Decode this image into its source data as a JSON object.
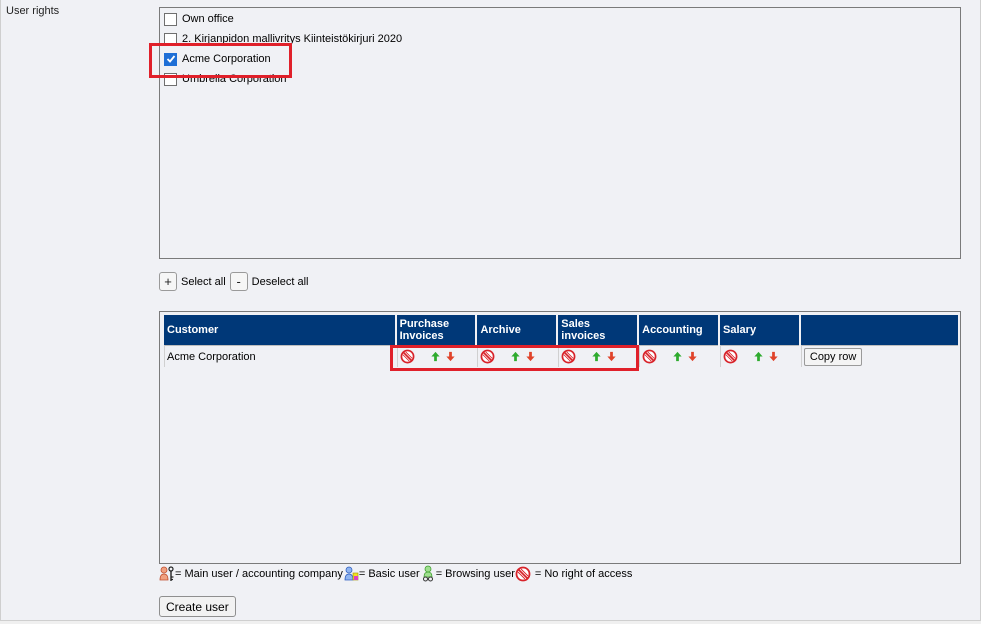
{
  "section_label": "User rights",
  "companies": [
    {
      "label": "Own office",
      "checked": false
    },
    {
      "label": "2. Kirjanpidon mallivritys Kiinteistökirjuri 2020",
      "checked": false
    },
    {
      "label": "Acme Corporation",
      "checked": true
    },
    {
      "label": "Umbrella Corporation",
      "checked": false
    }
  ],
  "select_bar": {
    "plus": "+",
    "select_all": "Select all",
    "minus": "-",
    "deselect_all": "Deselect all"
  },
  "rights_table": {
    "headers": {
      "customer": "Customer",
      "purchase_l1": "Purchase",
      "purchase_l2": "Invoices",
      "archive": "Archive",
      "sales_l1": "Sales",
      "sales_l2": "invoices",
      "accounting": "Accounting",
      "salary": "Salary",
      "actions": ""
    },
    "rows": [
      {
        "customer": "Acme Corporation",
        "copy_label": "Copy row",
        "rights": [
          "no-access",
          "no-access",
          "no-access",
          "no-access",
          "no-access"
        ]
      }
    ]
  },
  "legend": {
    "main_user": "= Main user / accounting company",
    "basic_user": "= Basic user",
    "browsing_user": "= Browsing user",
    "no_access": "= No right of access"
  },
  "create_button": "Create user",
  "colors": {
    "header_bg": "#003878",
    "highlight": "#e0202a",
    "arrow_up": "#2eab2e",
    "arrow_down": "#e0432a",
    "no_access": "#d8232a"
  }
}
